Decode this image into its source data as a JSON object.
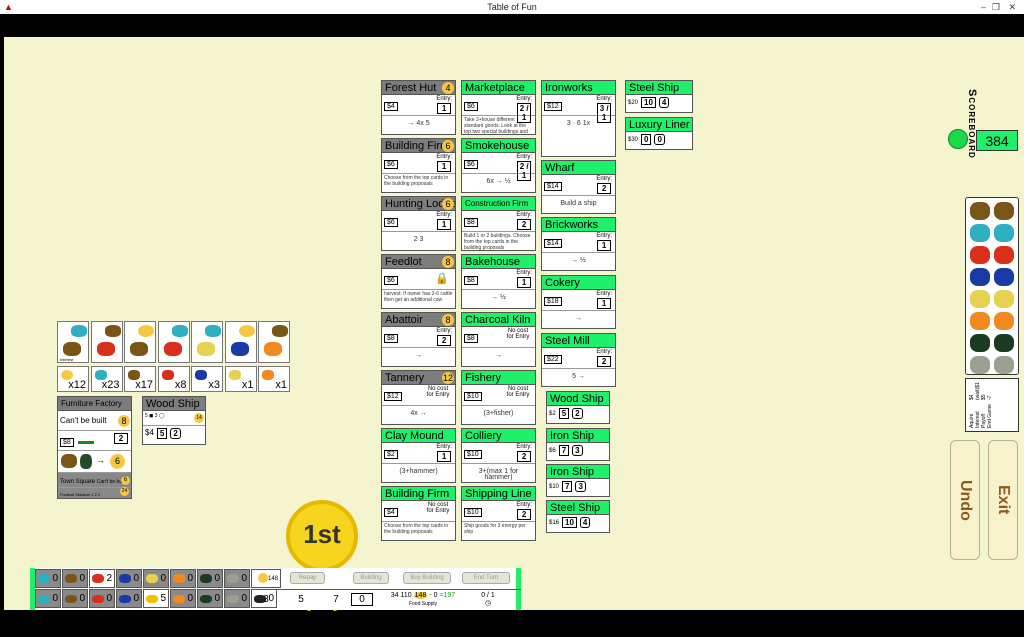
{
  "window": {
    "title": "Table of Fun",
    "app_icon": "a-logo-icon"
  },
  "colors": {
    "card_green": "#1ef06a",
    "card_gray": "#7d7d7d",
    "board_bg": "#f4f4cf",
    "coin": "#f6c840"
  },
  "cards": [
    {
      "name": "Forest Hut",
      "badge": "4",
      "hdr": "gray",
      "price": "$4",
      "entry": "1",
      "text": "→ 4x 5",
      "col": 0,
      "row": 0
    },
    {
      "name": "Building Firm",
      "badge": "6",
      "hdr": "gray",
      "price": "$6",
      "entry": "1",
      "text": "Choose from the top cards in the building proposals",
      "col": 0,
      "row": 1
    },
    {
      "name": "Hunting Lodge",
      "badge": "6",
      "hdr": "gray",
      "price": "$6",
      "entry": "1",
      "text": "2 3",
      "col": 0,
      "row": 2
    },
    {
      "name": "Feedlot",
      "badge": "8",
      "hdr": "gray",
      "price": "$6",
      "entry": "",
      "text": "harvest: If owner has 2-6 cattle then get an additional cow",
      "col": 0,
      "row": 3
    },
    {
      "name": "Abattoir",
      "badge": "8",
      "hdr": "gray",
      "price": "$8",
      "entry": "2",
      "text": "→",
      "col": 0,
      "row": 4
    },
    {
      "name": "Tannery",
      "badge": "12",
      "hdr": "gray",
      "price": "$12",
      "entry": "No cost for Entry",
      "text": "4x →",
      "col": 0,
      "row": 5
    },
    {
      "name": "Clay Mound",
      "badge": "",
      "hdr": "green",
      "price": "$2",
      "entry": "1",
      "text": "(3+hammer)",
      "col": 0,
      "row": 6
    },
    {
      "name": "Building Firm",
      "badge": "",
      "hdr": "green",
      "price": "$4",
      "entry": "No cost for Entry",
      "text": "Choose from the top cards in the building proposals",
      "col": 0,
      "row": 7
    },
    {
      "name": "Marketplace",
      "badge": "",
      "hdr": "green",
      "price": "$6",
      "entry": "2 / 1",
      "text": "Take 2+house different standard goods. Look at the top two special buildings and return them in any order.",
      "col": 1,
      "row": 0
    },
    {
      "name": "Smokehouse",
      "badge": "",
      "hdr": "green",
      "price": "$6",
      "entry": "2 / 1",
      "text": "6x → ½",
      "col": 1,
      "row": 1
    },
    {
      "name": "Construction Firm",
      "badge": "",
      "hdr": "green",
      "price": "$8",
      "entry": "2",
      "text": "Build 1 or 2 buildings. Choose from the top cards in the building proposals",
      "col": 1,
      "row": 2
    },
    {
      "name": "Bakehouse",
      "badge": "",
      "hdr": "green",
      "price": "$8",
      "entry": "1",
      "text": "→ ½",
      "col": 1,
      "row": 3
    },
    {
      "name": "Charcoal Kiln",
      "badge": "",
      "hdr": "green",
      "price": "$8",
      "entry": "No cost for Entry",
      "text": "→",
      "col": 1,
      "row": 4
    },
    {
      "name": "Fishery",
      "badge": "",
      "hdr": "green",
      "price": "$10",
      "entry": "No cost for Entry",
      "text": "(3+fisher)",
      "col": 1,
      "row": 5
    },
    {
      "name": "Colliery",
      "badge": "",
      "hdr": "green",
      "price": "$10",
      "entry": "2",
      "text": "3+(max 1 for hammer)",
      "col": 1,
      "row": 6
    },
    {
      "name": "Shipping Line",
      "badge": "",
      "hdr": "green",
      "price": "$10",
      "entry": "2",
      "text": "Ship goods for 3 energy per ship",
      "col": 1,
      "row": 7
    },
    {
      "name": "Ironworks",
      "badge": "",
      "hdr": "green",
      "price": "$12",
      "entry": "3 / 1",
      "text": "3 · 6 1x",
      "col": 2,
      "row": 0
    },
    {
      "name": "Wharf",
      "badge": "",
      "hdr": "green",
      "price": "$14",
      "entry": "2",
      "text": "Build a ship",
      "col": 2,
      "row": 1
    },
    {
      "name": "Brickworks",
      "badge": "",
      "hdr": "green",
      "price": "$14",
      "entry": "1",
      "text": "→ ½",
      "col": 2,
      "row": 2
    },
    {
      "name": "Cokery",
      "badge": "",
      "hdr": "green",
      "price": "$18",
      "entry": "1",
      "text": "→",
      "col": 2,
      "row": 3
    },
    {
      "name": "Steel Mill",
      "badge": "",
      "hdr": "green",
      "price": "$22",
      "entry": "2",
      "text": "5 →",
      "col": 2,
      "row": 4
    }
  ],
  "ships": [
    {
      "name": "Wood Ship",
      "cost": "$2",
      "food": "5",
      "cargo": "2"
    },
    {
      "name": "Iron Ship",
      "cost": "$6",
      "food": "7",
      "cargo": "3"
    },
    {
      "name": "Iron Ship",
      "cost": "$10",
      "food": "7",
      "cargo": "3"
    },
    {
      "name": "Steel Ship",
      "cost": "$16",
      "food": "10",
      "cargo": "4"
    },
    {
      "name": "Steel Ship",
      "cost": "$20",
      "food": "10",
      "cargo": "4"
    },
    {
      "name": "Luxury Liner",
      "cost": "$30",
      "food": "0",
      "cargo": "0"
    }
  ],
  "offers": {
    "label": "Interest",
    "counts": [
      "x12",
      "x23",
      "x17",
      "x8",
      "x3",
      "x1",
      "x1"
    ]
  },
  "player_cards": {
    "furniture": {
      "name": "Furniture Factory",
      "badge": "$26",
      "status": "Can't be built",
      "value": "8",
      "price": "$8",
      "entry": "2",
      "output": "6"
    },
    "town_square": {
      "name": "Town Square",
      "status": "Can't be built",
      "value": "6"
    },
    "stadium": {
      "name": "Football Stadium",
      "nums": [
        "1",
        "2",
        "2"
      ],
      "value": "24"
    },
    "wood_ship": {
      "name": "Wood Ship",
      "left": "5",
      "mid": "3",
      "value": "14",
      "cost": "$4",
      "food": "5",
      "cargo": "2"
    }
  },
  "bottom": {
    "top_row": [
      "0",
      "0",
      "2",
      "0",
      "0",
      "0",
      "0",
      "0"
    ],
    "bottom_row": [
      "0",
      "0",
      "0",
      "0",
      "5",
      "0",
      "0",
      "0",
      "0"
    ],
    "money": "148",
    "buttons": [
      "Repay",
      "Building",
      "Buy Building",
      "End Turn"
    ],
    "stats": [
      "3",
      "5",
      "7",
      "0"
    ],
    "food": {
      "ships": "34",
      "food": "110",
      "money": "148",
      "minus": "- 0",
      "total": "=197",
      "label": "Food Supply"
    },
    "round": "0 / 1"
  },
  "medal": "1st",
  "scoreboard": {
    "title": "Scoreboard",
    "score": "384"
  },
  "market_info": {
    "lines": [
      "Aquire",
      "Interest",
      "Payoff",
      "End Game"
    ],
    "values": [
      "$4",
      "(wait)$1",
      "$5",
      "-7"
    ]
  },
  "actions": {
    "undo": "Undo",
    "exit": "Exit"
  }
}
